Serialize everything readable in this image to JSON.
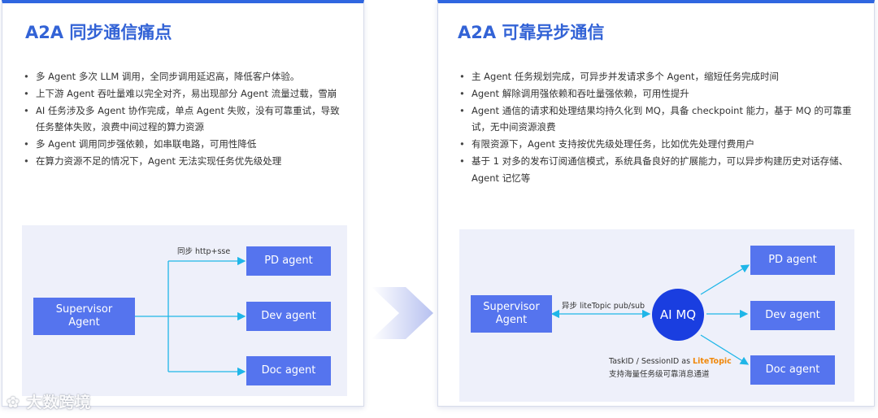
{
  "left": {
    "title": "A2A 同步通信痛点",
    "bullets": [
      "多 Agent 多次 LLM 调用，全同步调用延迟高，降低客户体验。",
      "上下游 Agent  吞吐量难以完全对齐，易出现部分 Agent 流量过载，雪崩",
      "AI 任务涉及多 Agent 协作完成，单点 Agent 失败，没有可靠重试，导致任务整体失败，浪费中间过程的算力资源",
      "多 Agent 调用同步强依赖，如串联电路，可用性降低",
      "在算力资源不足的情况下，Agent 无法实现任务优先级处理"
    ],
    "diagram": {
      "supervisor": [
        "Supervisor",
        "Agent"
      ],
      "edge_label": "同步 http+sse",
      "agents": [
        "PD agent",
        "Dev agent",
        "Doc agent"
      ]
    }
  },
  "right": {
    "title": "A2A 可靠异步通信",
    "bullets": [
      "主 Agent 任务规划完成，可异步并发请求多个 Agent，缩短任务完成时间",
      "Agent 解除调用强依赖和吞吐量强依赖，可用性提升",
      "Agent 通信的请求和处理结果均持久化到 MQ，具备 checkpoint 能力，基于 MQ 的可靠重试，无中间资源浪费",
      "有限资源下，Agent 支持按优先级处理任务，比如优先处理付费用户",
      "基于 1 对多的发布订阅通信模式，系统具备良好的扩展能力，可以异步构建历史对话存储、Agent 记忆等"
    ],
    "diagram": {
      "supervisor": [
        "Supervisor",
        "Agent"
      ],
      "edge_label": "异步 liteTopic pub/sub",
      "mq": "AI MQ",
      "agents": [
        "PD agent",
        "Dev agent",
        "Doc agent"
      ],
      "note_prefix": "TaskID / SessionID as ",
      "note_highlight": "LiteTopic",
      "note_line2": "支持海量任务级可靠消息通道"
    }
  },
  "watermark": "大数跨境",
  "colors": {
    "title": "#3363d6",
    "box": "#5574ee",
    "mq": "#1a3ee0",
    "line": "#1fb6e8",
    "highlight": "#f0880a",
    "diagram_bg": "#eef0fa"
  }
}
